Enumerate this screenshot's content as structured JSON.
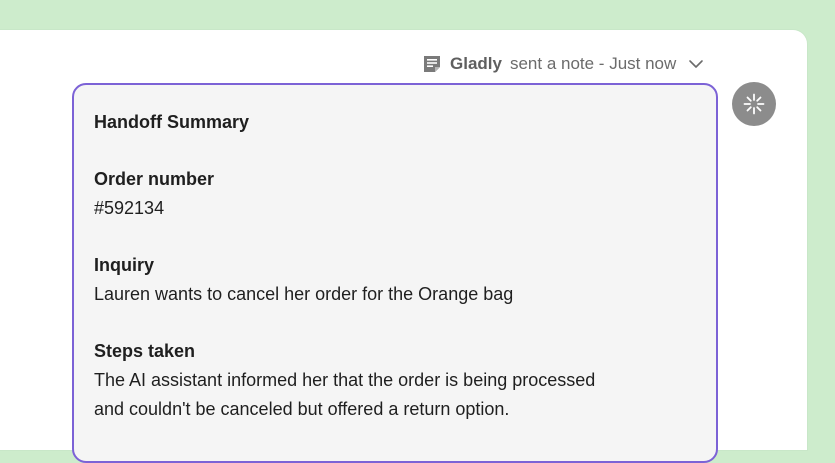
{
  "colors": {
    "background": "#cdeccc",
    "panel": "#ffffff",
    "card_border": "#7c62d6",
    "card_bg": "#f5f5f5",
    "avatar_bg": "#8c8c8c"
  },
  "note_header": {
    "icon": "note-icon",
    "sender": "Gladly",
    "text": "sent a note - Just now",
    "chevron": "chevron-down-icon"
  },
  "avatar": {
    "icon": "sparkle-icon"
  },
  "summary": {
    "title": "Handoff Summary",
    "order_label": "Order number",
    "order_value": "#592134",
    "inquiry_label": "Inquiry",
    "inquiry_value": "Lauren wants to cancel her order for the Orange bag",
    "steps_label": "Steps taken",
    "steps_line1": "The AI assistant informed her that the order is being processed",
    "steps_line2": "and couldn't be canceled but offered a return option."
  }
}
